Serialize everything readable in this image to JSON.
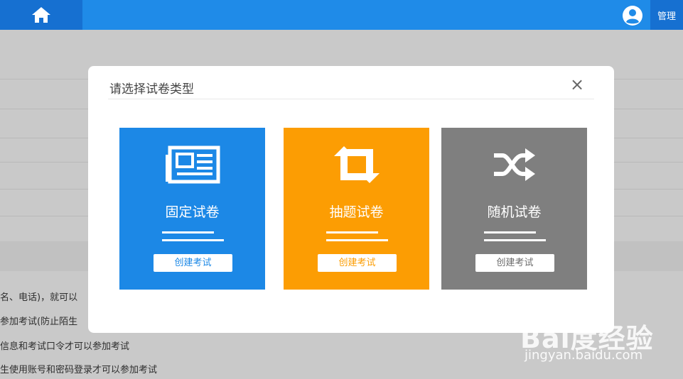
{
  "topbar": {
    "home_icon": "home-icon",
    "user_icon": "user-icon",
    "manage_label": "管理"
  },
  "background": {
    "lines": [
      "名、电话)，就可以",
      "参加考试(防止陌生",
      "信息和考试口令才可以参加考试",
      "生使用账号和密码登录才可以参加考试"
    ]
  },
  "modal": {
    "title": "请选择试卷类型",
    "close_label": "×",
    "cards": [
      {
        "label": "固定试卷",
        "button": "创建考试",
        "icon": "newspaper-icon",
        "color": "#1c88e6"
      },
      {
        "label": "抽题试卷",
        "button": "创建考试",
        "icon": "retweet-icon",
        "color": "#fc9d03"
      },
      {
        "label": "随机试卷",
        "button": "创建考试",
        "icon": "shuffle-icon",
        "color": "#7f7f7f"
      }
    ]
  },
  "watermark": {
    "logo": "Bai度经验",
    "url": "jingyan.baidu.com"
  }
}
